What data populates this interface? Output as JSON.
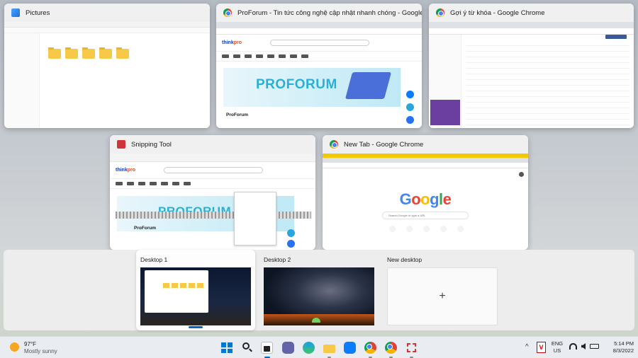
{
  "windows": {
    "pictures": {
      "title": "Pictures"
    },
    "proforum": {
      "title": "ProForum - Tin tức công nghệ cập nhật nhanh chóng - Google Ch...",
      "banner": "PROFORUM",
      "heading": "ProForum"
    },
    "keywords": {
      "title": "Gợi ý từ khóa - Google Chrome"
    },
    "snipping": {
      "title": "Snipping Tool",
      "banner": "PROFORUM",
      "heading": "ProForum"
    },
    "newtab": {
      "title": "New Tab - Google Chrome",
      "search_placeholder": "Search Google or type a URL"
    }
  },
  "desktops": {
    "d1": {
      "label": "Desktop 1"
    },
    "d2": {
      "label": "Desktop 2"
    },
    "new": {
      "label": "New desktop",
      "plus": "+"
    }
  },
  "weather": {
    "temp": "97°F",
    "desc": "Mostly sunny"
  },
  "tray": {
    "lang": "ENG",
    "region": "US",
    "time": "5:14 PM",
    "date": "8/3/2022",
    "up_arrow": "^"
  },
  "google_logo": {
    "g1": "G",
    "o1": "o",
    "o2": "o",
    "g2": "g",
    "l": "l",
    "e": "e"
  },
  "icon_colors": {
    "accent": "#0067c0",
    "folder": "#f7c948",
    "chrome_blue": "#4285f4"
  }
}
